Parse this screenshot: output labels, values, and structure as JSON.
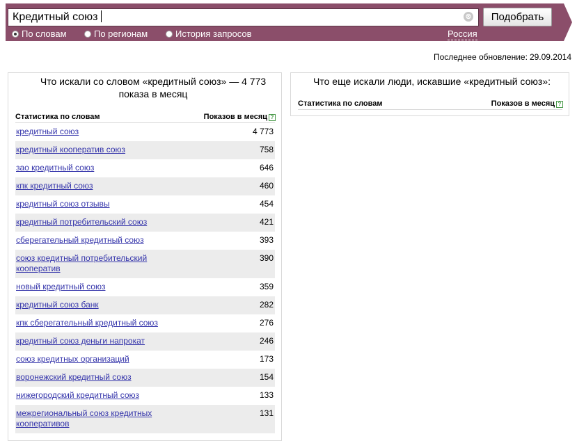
{
  "search": {
    "query": "Кредитный союз",
    "clear_glyph": "⊗",
    "submit_label": "Подобрать"
  },
  "modes": [
    {
      "label": "По словам",
      "checked": true
    },
    {
      "label": "По регионам",
      "checked": false
    },
    {
      "label": "История запросов",
      "checked": false
    }
  ],
  "region": "Россия",
  "updated": {
    "label": "Последнее обновление:",
    "date": "29.09.2014"
  },
  "left_panel": {
    "title": "Что искали со словом «кредитный союз» — 4 773 показа в месяц",
    "col_phrase": "Статистика по словам",
    "col_count": "Показов в месяц",
    "help_glyph": "?",
    "rows": [
      {
        "phrase": "кредитный союз",
        "count": "4 773"
      },
      {
        "phrase": "кредитный кооператив союз",
        "count": "758"
      },
      {
        "phrase": "зао кредитный союз",
        "count": "646"
      },
      {
        "phrase": "кпк кредитный союз",
        "count": "460"
      },
      {
        "phrase": "кредитный союз отзывы",
        "count": "454"
      },
      {
        "phrase": "кредитный потребительский союз",
        "count": "421"
      },
      {
        "phrase": "сберегательный кредитный союз",
        "count": "393"
      },
      {
        "phrase": "союз кредитный потребительский кооператив",
        "count": "390"
      },
      {
        "phrase": "новый кредитный союз",
        "count": "359"
      },
      {
        "phrase": "кредитный союз банк",
        "count": "282"
      },
      {
        "phrase": "кпк сберегательный кредитный союз",
        "count": "276"
      },
      {
        "phrase": "кредитный союз деньги напрокат",
        "count": "246"
      },
      {
        "phrase": "союз кредитных организаций",
        "count": "173"
      },
      {
        "phrase": "воронежский кредитный союз",
        "count": "154"
      },
      {
        "phrase": "нижегородский кредитный союз",
        "count": "133"
      },
      {
        "phrase": "межрегиональный союз кредитных кооперативов",
        "count": "131"
      }
    ]
  },
  "right_panel": {
    "title": "Что еще искали люди, искавшие «кредитный союз»:",
    "col_phrase": "Статистика по словам",
    "col_count": "Показов в месяц",
    "help_glyph": "?"
  },
  "colors": {
    "topbar": "#8b4e6a",
    "link": "#3333aa",
    "row_alt": "#ececec"
  }
}
